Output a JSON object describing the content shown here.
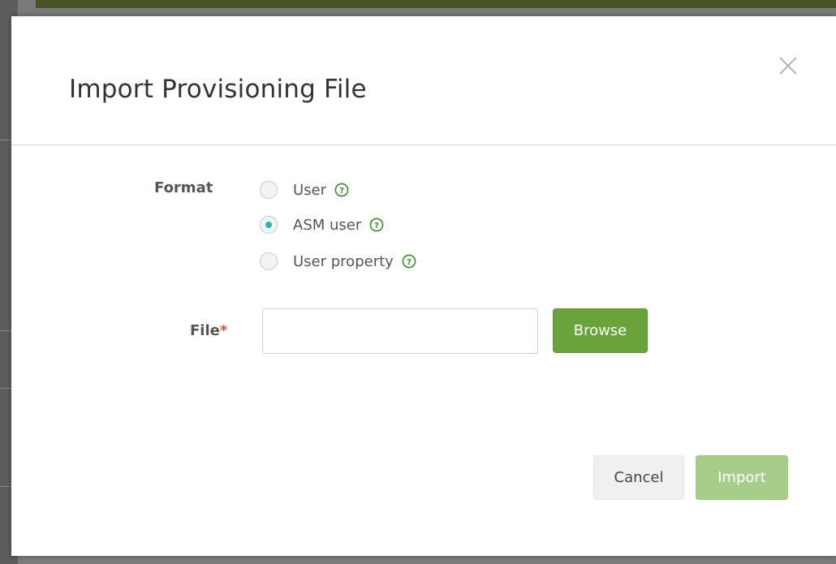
{
  "dialog": {
    "title": "Import Provisioning File",
    "close_icon": "close-icon"
  },
  "format": {
    "label": "Format",
    "options": [
      {
        "label": "User",
        "selected": false,
        "help_icon": "help-circle-icon"
      },
      {
        "label": "ASM user",
        "selected": true,
        "help_icon": "help-circle-icon"
      },
      {
        "label": "User property",
        "selected": false,
        "help_icon": "help-circle-icon"
      }
    ]
  },
  "file": {
    "label": "File",
    "required_marker": "*",
    "value": "",
    "browse_label": "Browse"
  },
  "footer": {
    "cancel_label": "Cancel",
    "import_label": "Import",
    "import_enabled": false
  },
  "colors": {
    "primary_green": "#6aa33c",
    "disabled_green": "#a7cd8a",
    "radio_accent": "#2bb3b1",
    "help_icon_green": "#3d8b2e",
    "required_red": "#e0522d"
  }
}
